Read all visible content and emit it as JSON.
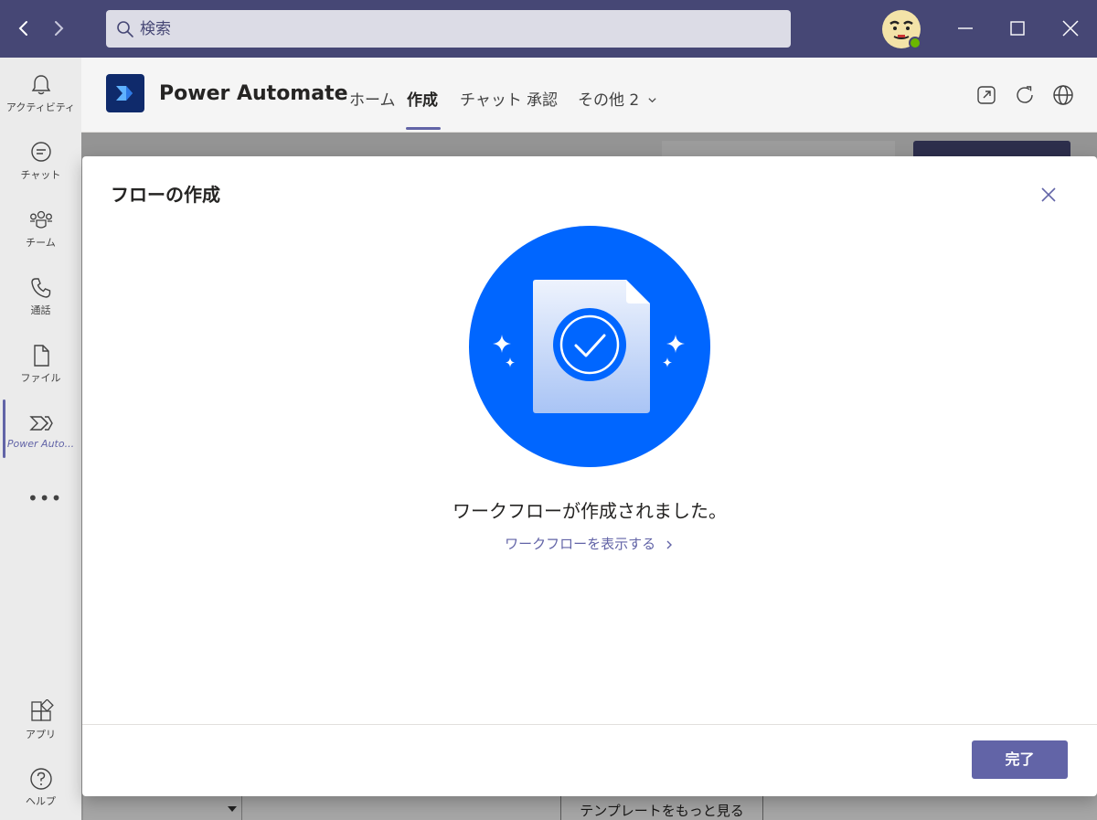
{
  "titlebar": {
    "search_placeholder": "検索",
    "icons": [
      "back-icon",
      "forward-icon",
      "search-icon",
      "minimize-icon",
      "maximize-icon",
      "close-icon"
    ]
  },
  "rail": {
    "items": [
      {
        "label": "アクティビティ",
        "icon": "bell-icon"
      },
      {
        "label": "チャット",
        "icon": "chat-icon"
      },
      {
        "label": "チーム",
        "icon": "teams-icon"
      },
      {
        "label": "通話",
        "icon": "phone-icon"
      },
      {
        "label": "ファイル",
        "icon": "file-icon"
      },
      {
        "label": "Power Auto...",
        "icon": "power-automate-icon",
        "active": true
      },
      {
        "label": "アプリ",
        "icon": "apps-icon"
      },
      {
        "label": "ヘルプ",
        "icon": "help-icon"
      }
    ],
    "more": "•••"
  },
  "app": {
    "title": "Power Automate",
    "tabs": [
      {
        "label": "ホーム"
      },
      {
        "label": "作成",
        "active": true
      },
      {
        "label": "チャット"
      },
      {
        "label": "承認"
      },
      {
        "label": "その他 2"
      }
    ]
  },
  "background": {
    "more_templates_label": "テンプレートをもっと見る"
  },
  "modal": {
    "title": "フローの作成",
    "message": "ワークフローが作成されました。",
    "link_label": "ワークフローを表示する",
    "done_label": "完了"
  },
  "colors": {
    "titlebar": "#464775",
    "accent": "#6264a7",
    "illustration_circle": "#0066ff",
    "presence": "#6bb700"
  }
}
